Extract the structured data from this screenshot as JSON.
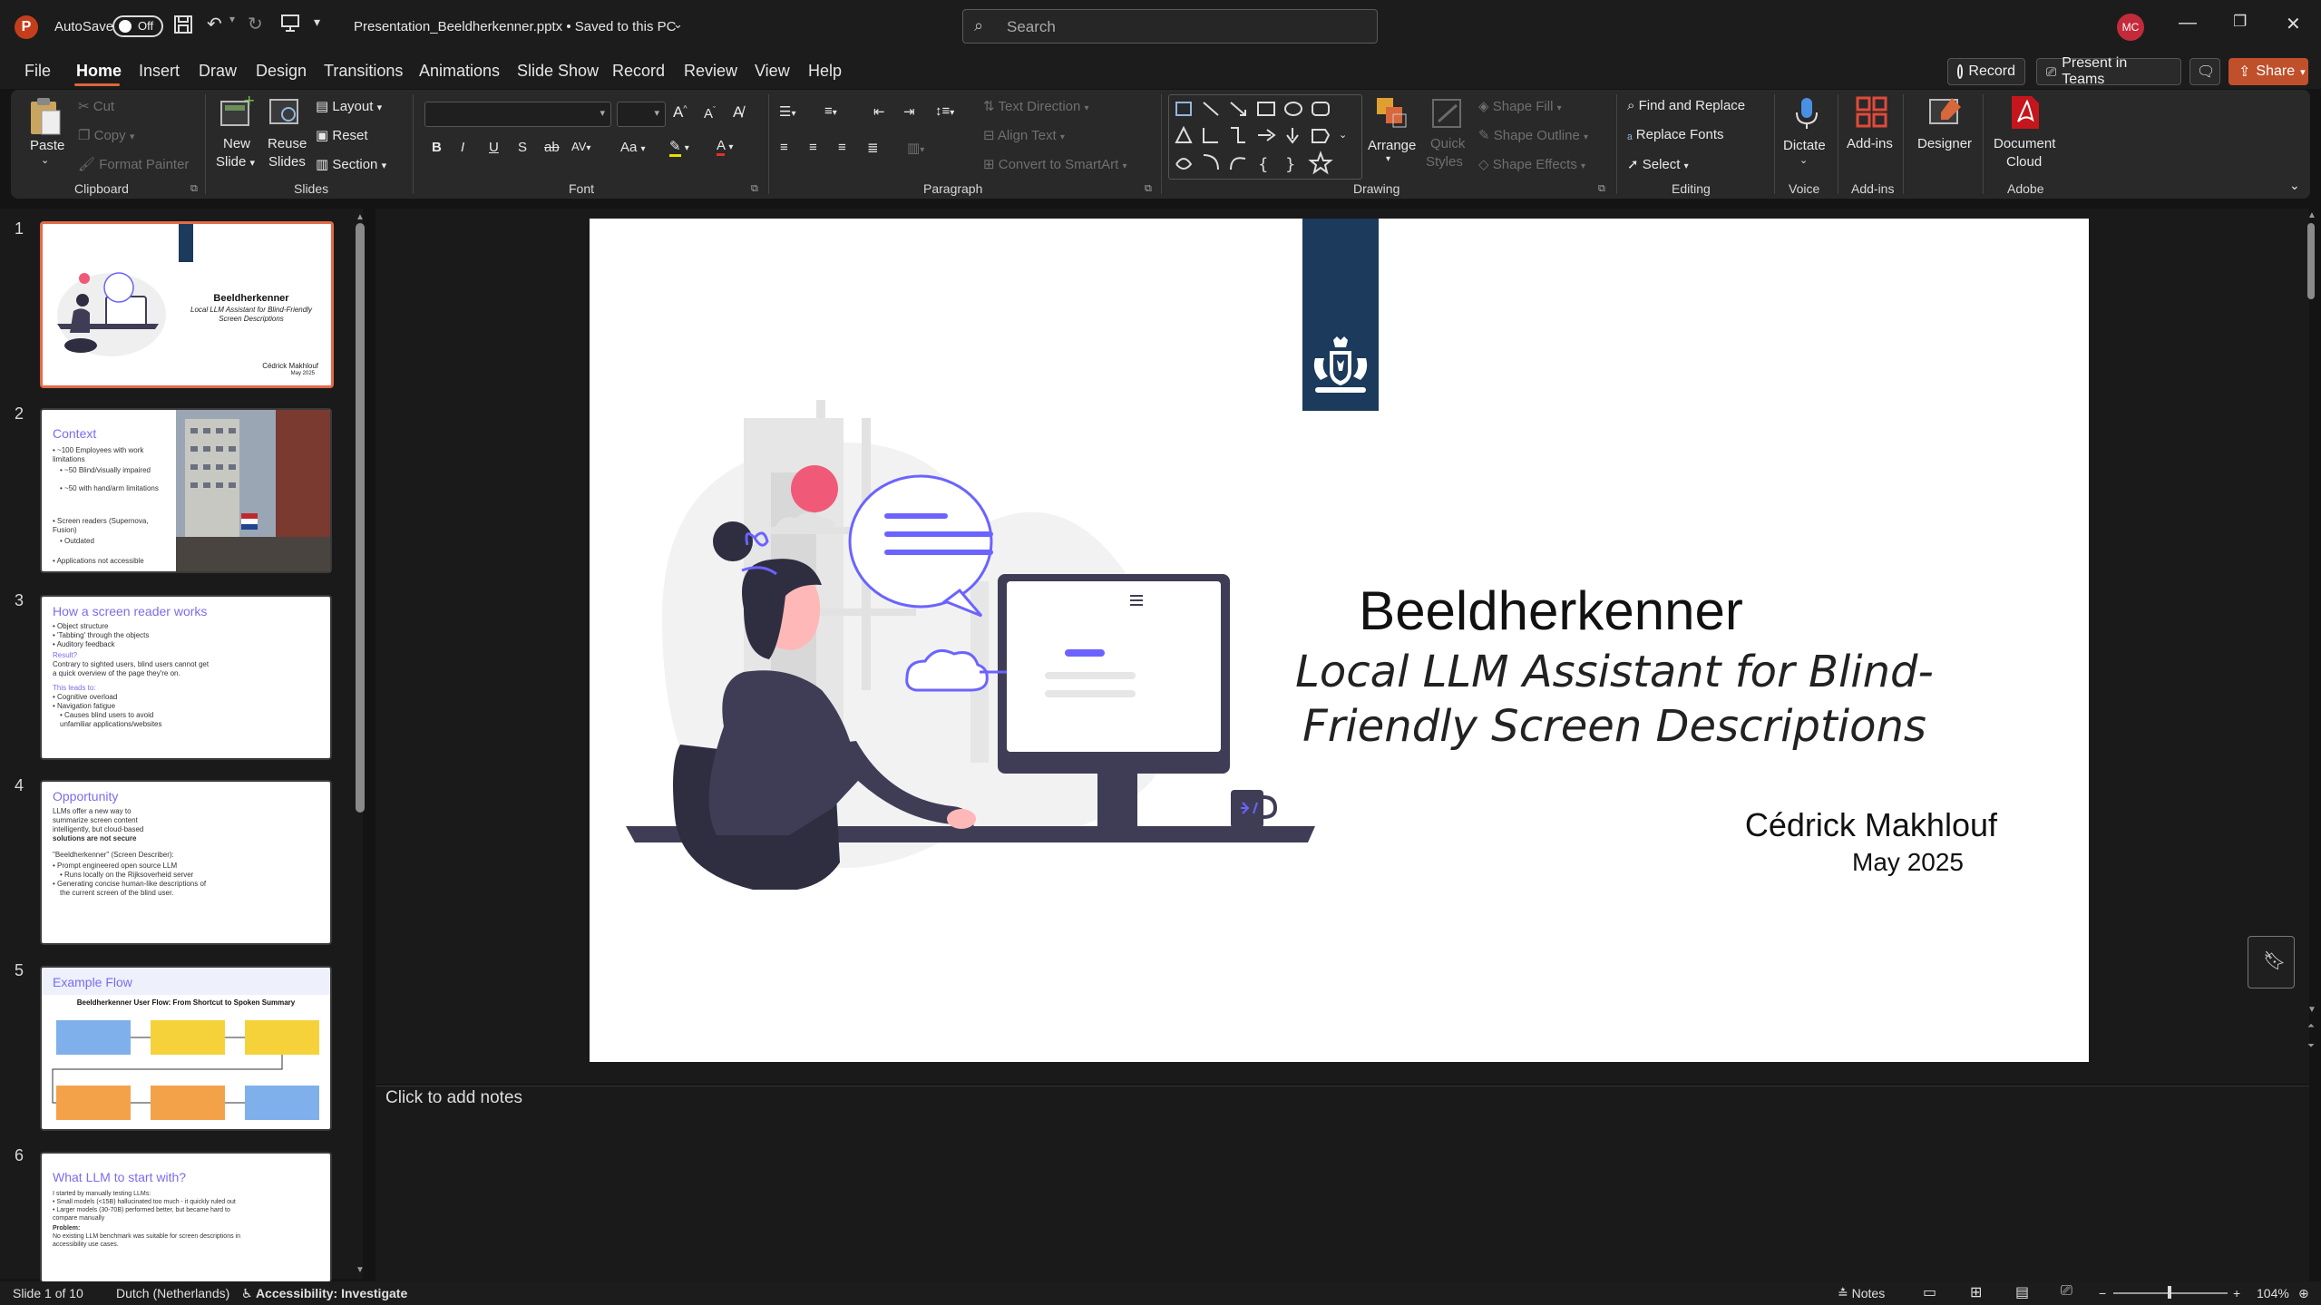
{
  "titlebar": {
    "autosave_label": "AutoSave",
    "autosave_state": "Off",
    "doc_title": "Presentation_Beeldherkenner.pptx • Saved to this PC",
    "search_placeholder": "Search",
    "user_initials": "MC",
    "app_letter": "P"
  },
  "tabs": [
    "File",
    "Home",
    "Insert",
    "Draw",
    "Design",
    "Transitions",
    "Animations",
    "Slide Show",
    "Record",
    "Review",
    "View",
    "Help"
  ],
  "actions": {
    "record": "Record",
    "present_in_teams": "Present in Teams",
    "share": "Share"
  },
  "ribbon": {
    "clipboard": {
      "paste": "Paste",
      "cut": "Cut",
      "copy": "Copy",
      "format_painter": "Format Painter",
      "group": "Clipboard"
    },
    "slides": {
      "new_slide_1": "New",
      "new_slide_2": "Slide",
      "reuse_1": "Reuse",
      "reuse_2": "Slides",
      "layout": "Layout",
      "reset": "Reset",
      "section": "Section",
      "group": "Slides"
    },
    "font": {
      "group": "Font",
      "b": "B",
      "i": "I",
      "u": "U",
      "s": "S",
      "av": "AV",
      "aa": "Aa"
    },
    "paragraph": {
      "text_direction": "Text Direction",
      "align_text": "Align Text",
      "smartart": "Convert to SmartArt",
      "group": "Paragraph"
    },
    "drawing": {
      "arrange": "Arrange",
      "quick_styles_1": "Quick",
      "quick_styles_2": "Styles",
      "shape_fill": "Shape Fill",
      "shape_outline": "Shape Outline",
      "shape_effects": "Shape Effects",
      "group": "Drawing"
    },
    "editing": {
      "find_replace": "Find and Replace",
      "replace_fonts": "Replace Fonts",
      "select": "Select",
      "group": "Editing"
    },
    "voice": {
      "dictate": "Dictate",
      "group": "Voice"
    },
    "addins": {
      "addins": "Add-ins",
      "group": "Add-ins"
    },
    "designer": {
      "designer": "Designer"
    },
    "adobe": {
      "doc_cloud_1": "Document",
      "doc_cloud_2": "Cloud",
      "group": "Adobe"
    }
  },
  "thumbnails": [
    {
      "num": "1",
      "title": "Beeldherkenner",
      "sub": "Local LLM Assistant for Blind-Friendly Screen Descriptions",
      "author": "Cédrick Makhlouf",
      "date": "May 2025"
    },
    {
      "num": "2",
      "title": "Context",
      "lines": [
        "• ~100 Employees with work limitations",
        "  • ~50 Blind/visually impaired",
        "  • ~50 with hand/arm limitations",
        "• Screen readers (Supernova, Fusion)",
        "  • Outdated",
        "• Applications not accessible"
      ]
    },
    {
      "num": "3",
      "title": "How a screen reader works",
      "lines": [
        "• Object structure",
        "• 'Tabbing' through the objects",
        "• Auditory feedback",
        "Result?",
        "Contrary to sighted users, blind users cannot get",
        "a quick overview of the page they're on.",
        "This leads to:",
        "• Cognitive overload",
        "• Navigation fatigue",
        "  • Causes blind users to avoid",
        "    unfamiliar applications/websites"
      ]
    },
    {
      "num": "4",
      "title": "Opportunity",
      "lines": [
        "LLMs offer a new way to",
        "summarize screen content",
        "intelligently, but cloud-based",
        "solutions are not secure",
        "\"Beeldherkenner\" (Screen Describer):",
        "• Prompt engineered open source LLM",
        "  • Runs locally on the Rijksoverheid server",
        "• Generating concise human-like descriptions of",
        "  the current screen of the blind user."
      ]
    },
    {
      "num": "5",
      "title": "Example Flow",
      "flow_title": "Beeldherkenner User Flow: From Shortcut to Spoken Summary"
    },
    {
      "num": "6",
      "title": "What LLM to start with?",
      "lines": [
        "I started by manually testing LLMs:",
        "• Small models (<15B) hallucinated too much - it quickly ruled out",
        "• Larger models (30-70B) performed better, but became hard to",
        "  compare manually",
        "Problem:",
        "No existing LLM benchmark was suitable for screen descriptions in",
        "accessibility use cases."
      ]
    }
  ],
  "slide": {
    "title": "Beeldherkenner",
    "subtitle_1": "Local LLM Assistant for Blind-",
    "subtitle_2": "Friendly Screen Descriptions",
    "author": "Cédrick Makhlouf",
    "date": "May 2025"
  },
  "notes_placeholder": "Click to add notes",
  "status": {
    "slide_of": "Slide 1 of 10",
    "language": "Dutch (Netherlands)",
    "accessibility": "Accessibility: Investigate",
    "notes": "Notes",
    "zoom": "104%"
  },
  "colors": {
    "accent": "#d9673c",
    "banner": "#1b3a5c",
    "illustration_purple": "#6c63ff",
    "illustration_pink": "#f05a78"
  }
}
